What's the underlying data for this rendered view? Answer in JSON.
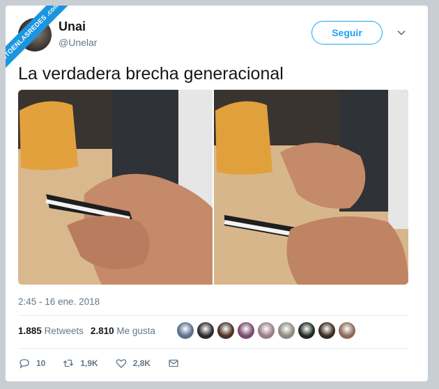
{
  "watermark": "VISTOENLASREDES .com",
  "author": {
    "name": "Unai",
    "handle": "@Unelar"
  },
  "follow_button": "Seguir",
  "tweet": {
    "text": "La verdadera brecha generacional"
  },
  "timestamp": "2:45 - 16 ene. 2018",
  "stats": {
    "retweets_count": "1.885",
    "retweets_label": "Retweets",
    "likes_count": "2.810",
    "likes_label": "Me gusta"
  },
  "likers": [
    {
      "color": "#5b6f8c"
    },
    {
      "color": "#2b2b2b"
    },
    {
      "color": "#4a3226"
    },
    {
      "color": "#7a4a6e"
    },
    {
      "color": "#9a7d86"
    },
    {
      "color": "#8c8a7c"
    },
    {
      "color": "#1f2a22"
    },
    {
      "color": "#3b2a1e"
    },
    {
      "color": "#8a6a5a"
    }
  ],
  "actions": {
    "replies": "10",
    "retweets": "1,9K",
    "likes": "2,8K"
  },
  "icons": [
    "reply-icon",
    "retweet-icon",
    "heart-icon",
    "message-icon",
    "chevron-down-icon"
  ],
  "colors": {
    "accent": "#1da1f2",
    "muted": "#657786",
    "watermark": "#1b95e0"
  }
}
